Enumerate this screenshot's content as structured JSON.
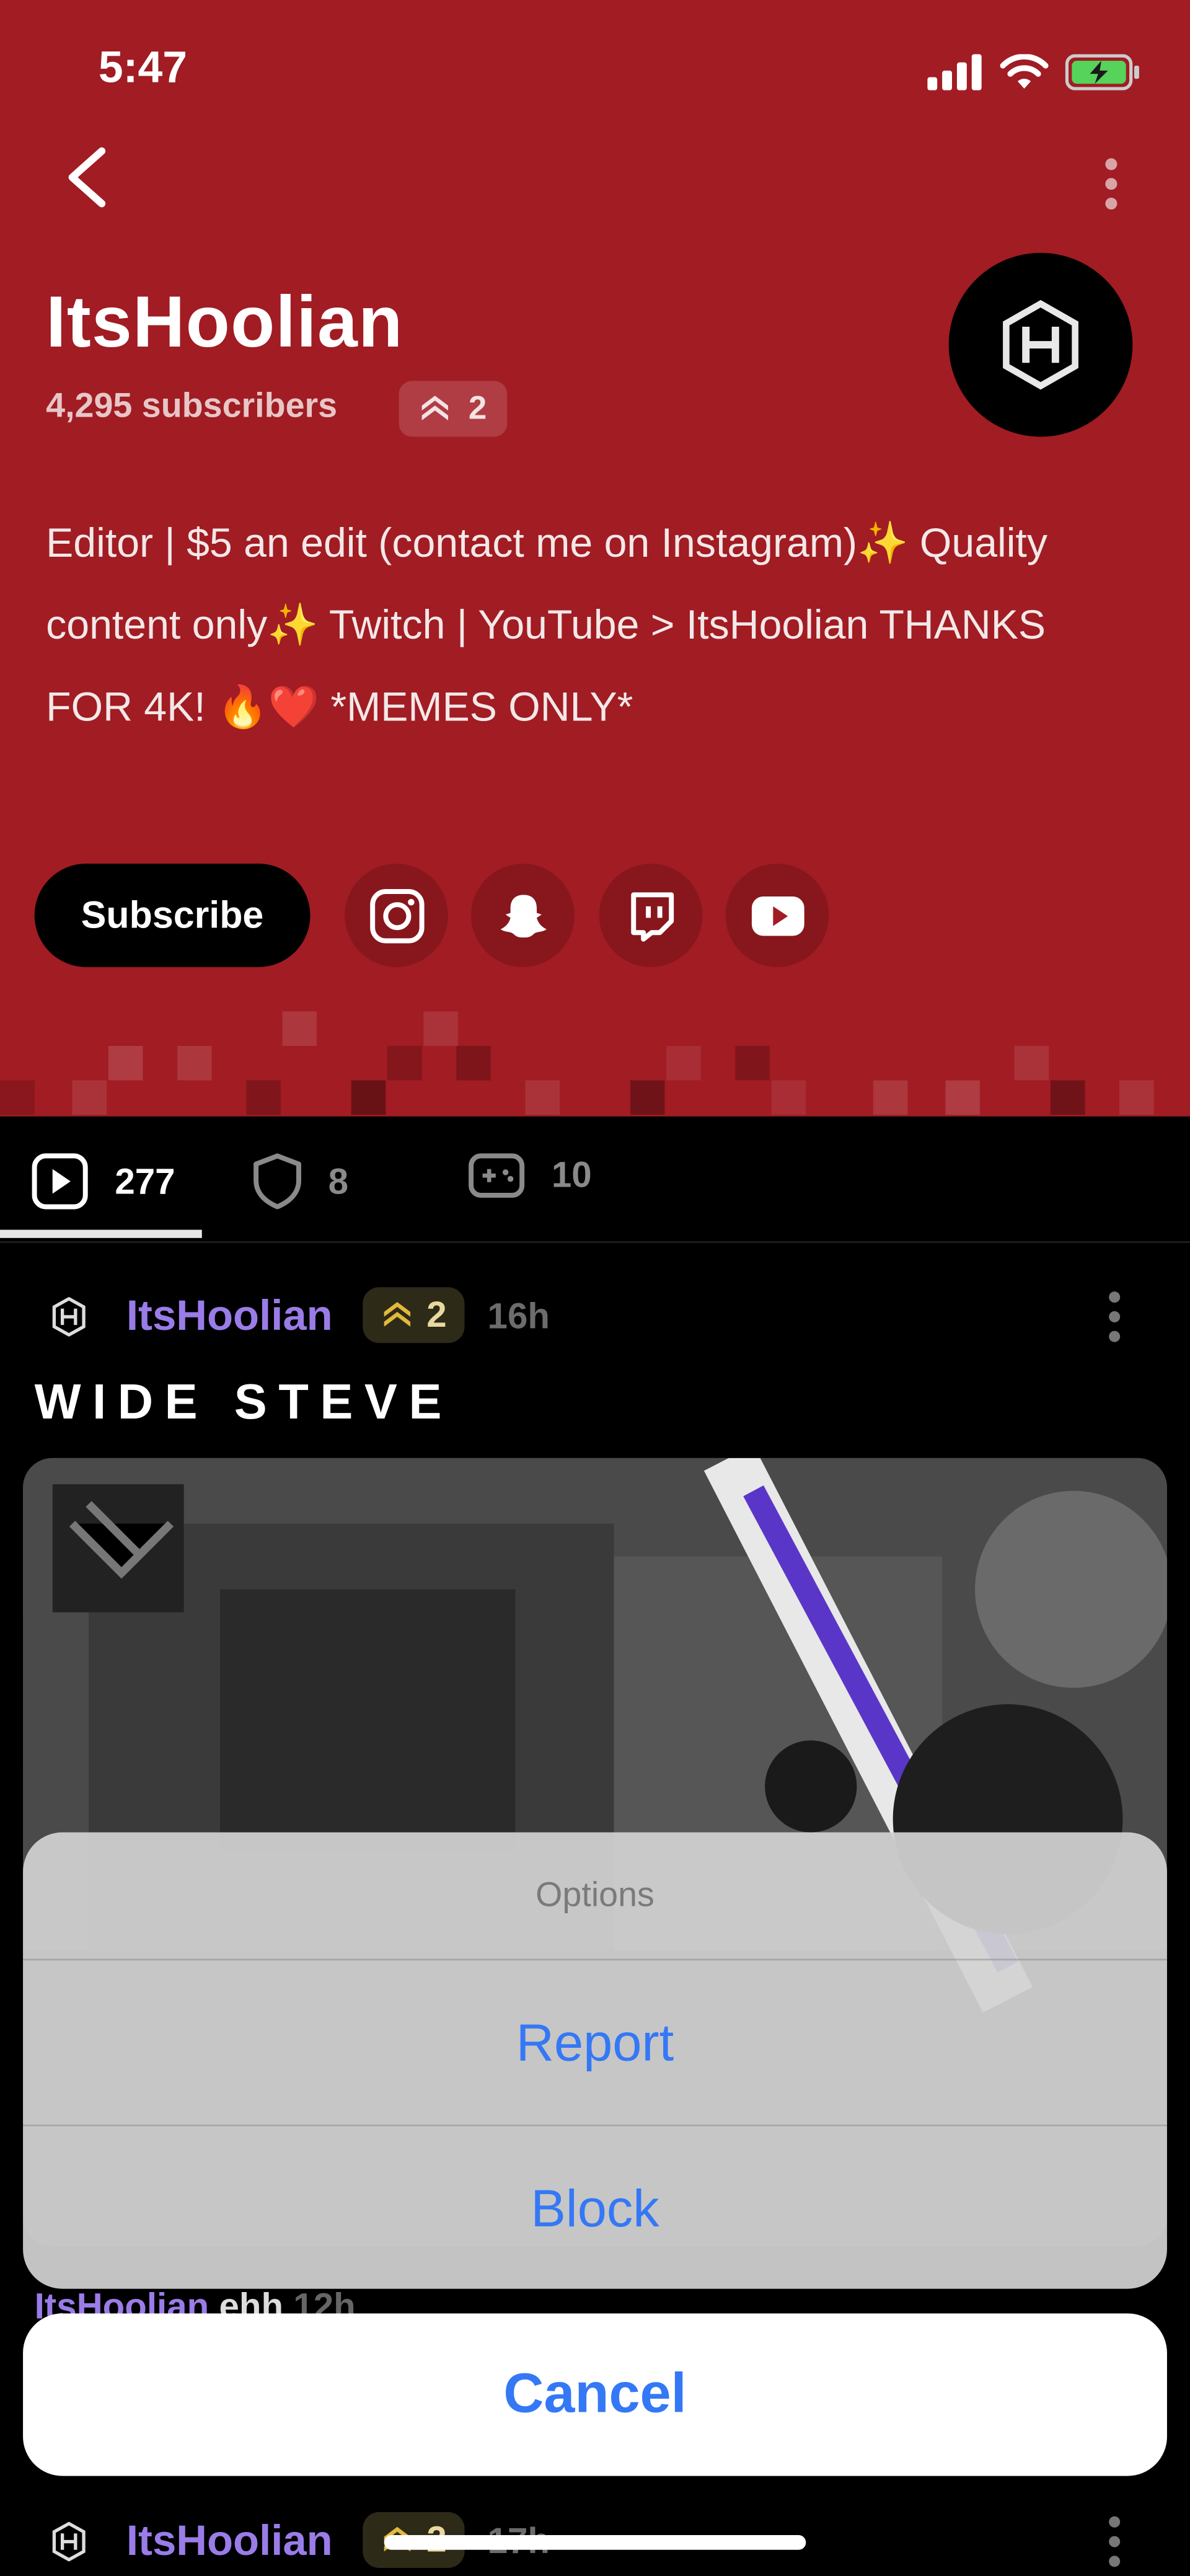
{
  "status_bar": {
    "time": "5:47"
  },
  "channel": {
    "name": "ItsHoolian",
    "subscribers": "4,295 subscribers",
    "badge_level": "2",
    "bio": "Editor | $5 an edit (contact me on Instagram)✨ Quality content only✨  Twitch | YouTube > ItsHoolian  THANKS FOR 4K! 🔥❤️ *MEMES ONLY*",
    "subscribe_label": "Subscribe",
    "social_icons": [
      "instagram-icon",
      "snapchat-icon",
      "twitch-icon",
      "youtube-icon"
    ],
    "header_color": "#a11c23"
  },
  "tabs": [
    {
      "icon": "play-icon",
      "count": "277"
    },
    {
      "icon": "shield-icon",
      "count": "8"
    },
    {
      "icon": "gamepad-icon",
      "count": "10"
    }
  ],
  "post": {
    "author": "ItsHoolian",
    "badge_level": "2",
    "time": "16h",
    "title": "WIDE STEVE"
  },
  "comment_peek": {
    "author": "ItsHoolian",
    "text": "ehh",
    "time": "12h"
  },
  "action_sheet": {
    "title": "Options",
    "options": [
      "Report",
      "Block"
    ],
    "cancel": "Cancel"
  },
  "next_post": {
    "author": "ItsHoolian",
    "badge_level": "2",
    "time": "17h"
  },
  "colors": {
    "accent_blue": "#3478f6",
    "author_purple": "#9a7ce8"
  }
}
